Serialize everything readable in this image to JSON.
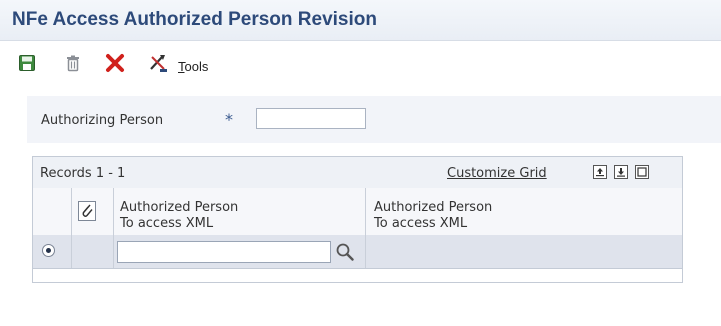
{
  "title": "NFe Access Authorized Person Revision",
  "toolbar": {
    "save_icon": "save-icon",
    "delete_icon": "trash-icon",
    "cancel_icon": "close-icon",
    "tools_icon": "tools-icon",
    "tools_prefix": "T",
    "tools_rest": "ools"
  },
  "form": {
    "authorizing_person_label": "Authorizing Person",
    "required_marker": "*",
    "authorizing_person_value": ""
  },
  "grid": {
    "records_label": "Records 1 - 1",
    "customize_label": "Customize Grid",
    "columns": [
      {
        "line1": "Authorized Person",
        "line2": "To access XML"
      },
      {
        "line1": "Authorized Person",
        "line2": "To access XML"
      }
    ],
    "rows": [
      {
        "selected": true,
        "authorized_person": "",
        "authorized_person_desc": ""
      }
    ]
  },
  "colors": {
    "title": "#2d4a7a",
    "accent": "#3a5a8f",
    "cancel_red": "#d0211c",
    "save_green": "#3f8a3f"
  }
}
